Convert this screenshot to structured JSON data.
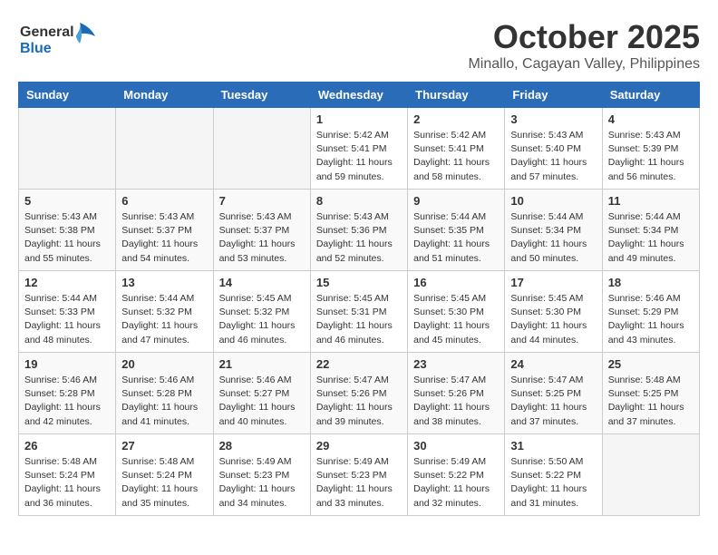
{
  "header": {
    "logo_general": "General",
    "logo_blue": "Blue",
    "month": "October 2025",
    "location": "Minallo, Cagayan Valley, Philippines"
  },
  "weekdays": [
    "Sunday",
    "Monday",
    "Tuesday",
    "Wednesday",
    "Thursday",
    "Friday",
    "Saturday"
  ],
  "weeks": [
    [
      {
        "day": "",
        "info": ""
      },
      {
        "day": "",
        "info": ""
      },
      {
        "day": "",
        "info": ""
      },
      {
        "day": "1",
        "info": "Sunrise: 5:42 AM\nSunset: 5:41 PM\nDaylight: 11 hours\nand 59 minutes."
      },
      {
        "day": "2",
        "info": "Sunrise: 5:42 AM\nSunset: 5:41 PM\nDaylight: 11 hours\nand 58 minutes."
      },
      {
        "day": "3",
        "info": "Sunrise: 5:43 AM\nSunset: 5:40 PM\nDaylight: 11 hours\nand 57 minutes."
      },
      {
        "day": "4",
        "info": "Sunrise: 5:43 AM\nSunset: 5:39 PM\nDaylight: 11 hours\nand 56 minutes."
      }
    ],
    [
      {
        "day": "5",
        "info": "Sunrise: 5:43 AM\nSunset: 5:38 PM\nDaylight: 11 hours\nand 55 minutes."
      },
      {
        "day": "6",
        "info": "Sunrise: 5:43 AM\nSunset: 5:37 PM\nDaylight: 11 hours\nand 54 minutes."
      },
      {
        "day": "7",
        "info": "Sunrise: 5:43 AM\nSunset: 5:37 PM\nDaylight: 11 hours\nand 53 minutes."
      },
      {
        "day": "8",
        "info": "Sunrise: 5:43 AM\nSunset: 5:36 PM\nDaylight: 11 hours\nand 52 minutes."
      },
      {
        "day": "9",
        "info": "Sunrise: 5:44 AM\nSunset: 5:35 PM\nDaylight: 11 hours\nand 51 minutes."
      },
      {
        "day": "10",
        "info": "Sunrise: 5:44 AM\nSunset: 5:34 PM\nDaylight: 11 hours\nand 50 minutes."
      },
      {
        "day": "11",
        "info": "Sunrise: 5:44 AM\nSunset: 5:34 PM\nDaylight: 11 hours\nand 49 minutes."
      }
    ],
    [
      {
        "day": "12",
        "info": "Sunrise: 5:44 AM\nSunset: 5:33 PM\nDaylight: 11 hours\nand 48 minutes."
      },
      {
        "day": "13",
        "info": "Sunrise: 5:44 AM\nSunset: 5:32 PM\nDaylight: 11 hours\nand 47 minutes."
      },
      {
        "day": "14",
        "info": "Sunrise: 5:45 AM\nSunset: 5:32 PM\nDaylight: 11 hours\nand 46 minutes."
      },
      {
        "day": "15",
        "info": "Sunrise: 5:45 AM\nSunset: 5:31 PM\nDaylight: 11 hours\nand 46 minutes."
      },
      {
        "day": "16",
        "info": "Sunrise: 5:45 AM\nSunset: 5:30 PM\nDaylight: 11 hours\nand 45 minutes."
      },
      {
        "day": "17",
        "info": "Sunrise: 5:45 AM\nSunset: 5:30 PM\nDaylight: 11 hours\nand 44 minutes."
      },
      {
        "day": "18",
        "info": "Sunrise: 5:46 AM\nSunset: 5:29 PM\nDaylight: 11 hours\nand 43 minutes."
      }
    ],
    [
      {
        "day": "19",
        "info": "Sunrise: 5:46 AM\nSunset: 5:28 PM\nDaylight: 11 hours\nand 42 minutes."
      },
      {
        "day": "20",
        "info": "Sunrise: 5:46 AM\nSunset: 5:28 PM\nDaylight: 11 hours\nand 41 minutes."
      },
      {
        "day": "21",
        "info": "Sunrise: 5:46 AM\nSunset: 5:27 PM\nDaylight: 11 hours\nand 40 minutes."
      },
      {
        "day": "22",
        "info": "Sunrise: 5:47 AM\nSunset: 5:26 PM\nDaylight: 11 hours\nand 39 minutes."
      },
      {
        "day": "23",
        "info": "Sunrise: 5:47 AM\nSunset: 5:26 PM\nDaylight: 11 hours\nand 38 minutes."
      },
      {
        "day": "24",
        "info": "Sunrise: 5:47 AM\nSunset: 5:25 PM\nDaylight: 11 hours\nand 37 minutes."
      },
      {
        "day": "25",
        "info": "Sunrise: 5:48 AM\nSunset: 5:25 PM\nDaylight: 11 hours\nand 37 minutes."
      }
    ],
    [
      {
        "day": "26",
        "info": "Sunrise: 5:48 AM\nSunset: 5:24 PM\nDaylight: 11 hours\nand 36 minutes."
      },
      {
        "day": "27",
        "info": "Sunrise: 5:48 AM\nSunset: 5:24 PM\nDaylight: 11 hours\nand 35 minutes."
      },
      {
        "day": "28",
        "info": "Sunrise: 5:49 AM\nSunset: 5:23 PM\nDaylight: 11 hours\nand 34 minutes."
      },
      {
        "day": "29",
        "info": "Sunrise: 5:49 AM\nSunset: 5:23 PM\nDaylight: 11 hours\nand 33 minutes."
      },
      {
        "day": "30",
        "info": "Sunrise: 5:49 AM\nSunset: 5:22 PM\nDaylight: 11 hours\nand 32 minutes."
      },
      {
        "day": "31",
        "info": "Sunrise: 5:50 AM\nSunset: 5:22 PM\nDaylight: 11 hours\nand 31 minutes."
      },
      {
        "day": "",
        "info": ""
      }
    ]
  ]
}
